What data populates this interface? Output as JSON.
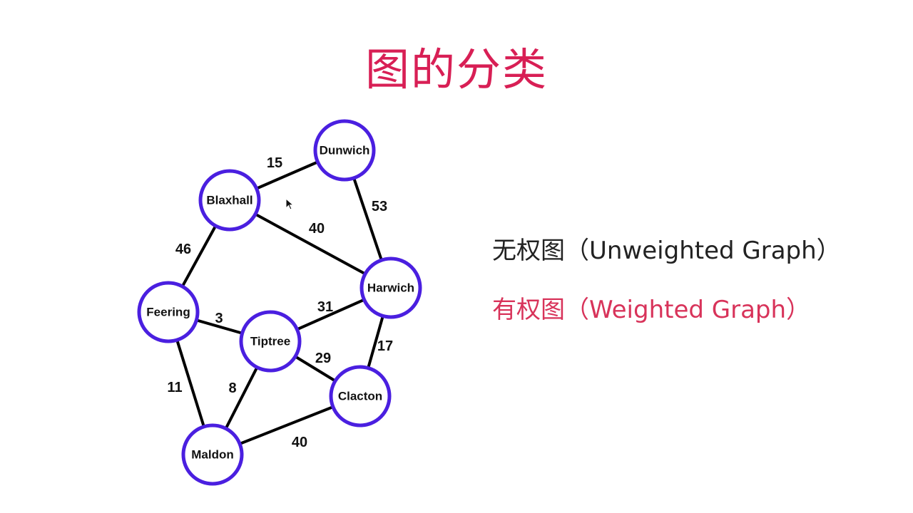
{
  "title": "图的分类",
  "legend": {
    "unweighted": "无权图（Unweighted Graph）",
    "weighted": "有权图（Weighted Graph）"
  },
  "colors": {
    "title": "#d81f55",
    "node_stroke": "#4a1fe0",
    "edge": "#000000",
    "weighted_text": "#d8335a",
    "unweighted_text": "#222222"
  },
  "graph": {
    "nodes": [
      {
        "id": "dunwich",
        "label": "Dunwich"
      },
      {
        "id": "blaxhall",
        "label": "Blaxhall"
      },
      {
        "id": "harwich",
        "label": "Harwich"
      },
      {
        "id": "feering",
        "label": "Feering"
      },
      {
        "id": "tiptree",
        "label": "Tiptree"
      },
      {
        "id": "clacton",
        "label": "Clacton"
      },
      {
        "id": "maldon",
        "label": "Maldon"
      }
    ],
    "edges": [
      {
        "from": "blaxhall",
        "to": "dunwich",
        "weight": "15"
      },
      {
        "from": "dunwich",
        "to": "harwich",
        "weight": "53"
      },
      {
        "from": "blaxhall",
        "to": "harwich",
        "weight": "40"
      },
      {
        "from": "blaxhall",
        "to": "feering",
        "weight": "46"
      },
      {
        "from": "feering",
        "to": "tiptree",
        "weight": "3"
      },
      {
        "from": "tiptree",
        "to": "harwich",
        "weight": "31"
      },
      {
        "from": "harwich",
        "to": "clacton",
        "weight": "17"
      },
      {
        "from": "tiptree",
        "to": "clacton",
        "weight": "29"
      },
      {
        "from": "feering",
        "to": "maldon",
        "weight": "11"
      },
      {
        "from": "tiptree",
        "to": "maldon",
        "weight": "8"
      },
      {
        "from": "maldon",
        "to": "clacton",
        "weight": "40"
      }
    ]
  },
  "icons": {
    "cursor": "mouse-pointer-icon"
  }
}
